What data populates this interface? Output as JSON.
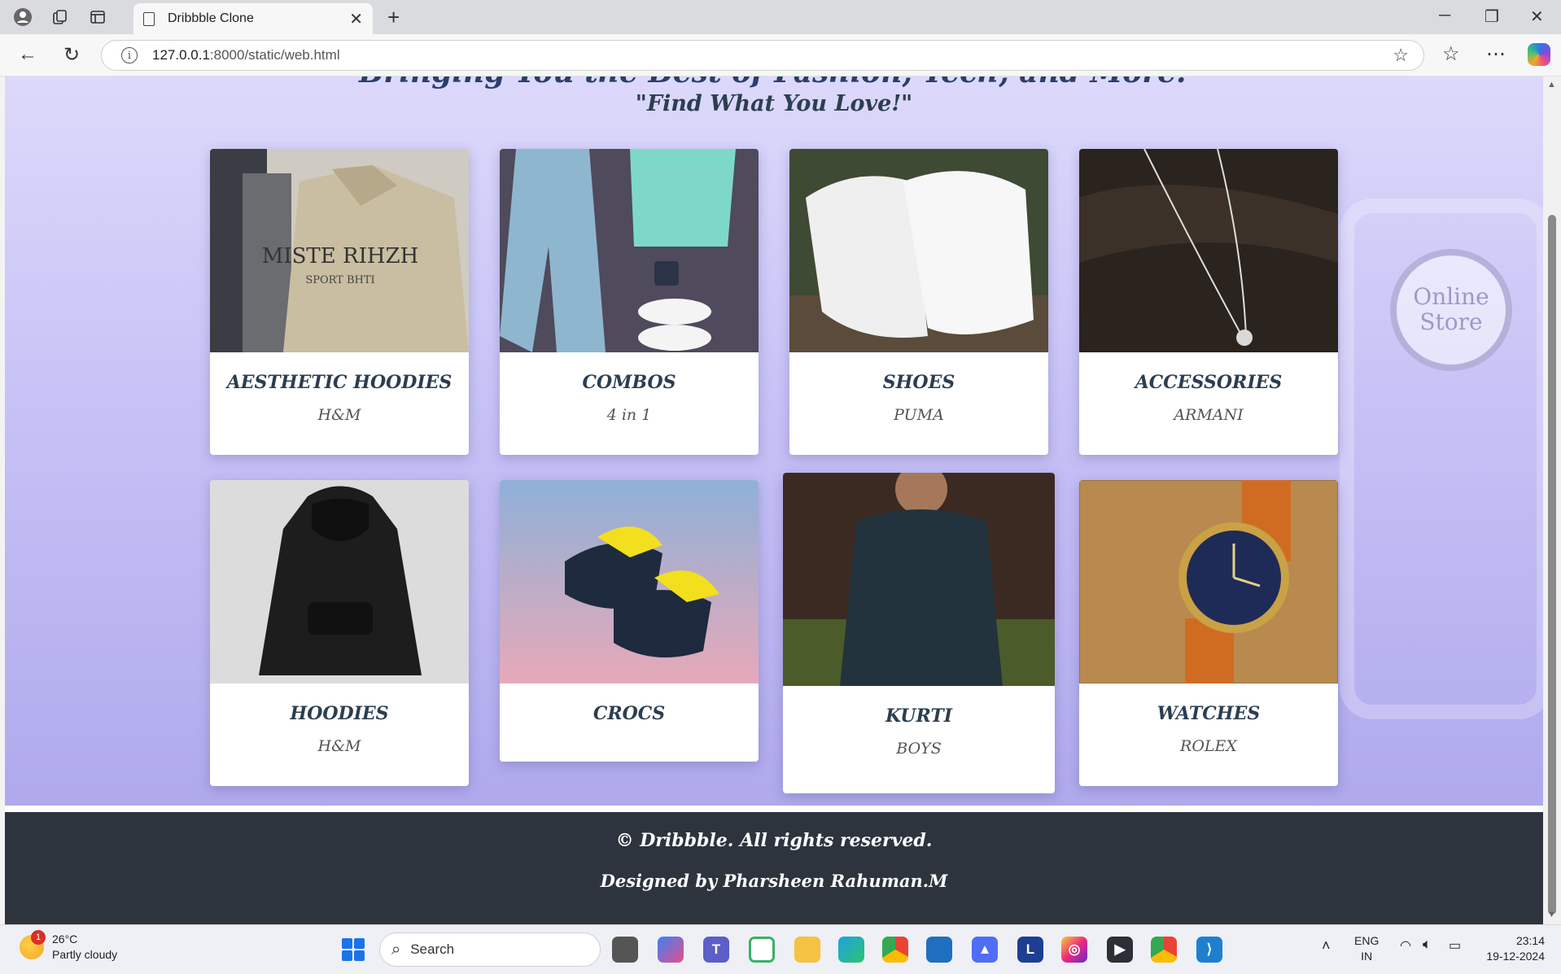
{
  "browser": {
    "tab_title": "Dribbble Clone",
    "url_host": "127.0.0.1",
    "url_rest": ":8000/static/web.html"
  },
  "hero": {
    "headline_partial": "Bringing You the Best of Fashion, Tech, and More!",
    "tagline": "\"Find What You Love!\""
  },
  "background": {
    "badge_text_line1": "Online",
    "badge_text_line2": "Store"
  },
  "cards": [
    {
      "name": "AESTHETIC HOODIES",
      "brand": "H&M",
      "image": "beige-hoodie-photo"
    },
    {
      "name": "COMBOS",
      "brand": "4 in 1",
      "image": "jeans-polo-sneakers-photo"
    },
    {
      "name": "SHOES",
      "brand": "PUMA",
      "image": "white-sneakers-photo"
    },
    {
      "name": "ACCESSORIES",
      "brand": "ARMANI",
      "image": "silver-necklace-photo"
    },
    {
      "name": "HOODIES",
      "brand": "H&M",
      "image": "black-hoodie-photo"
    },
    {
      "name": "CROCS",
      "brand": "",
      "image": "crocs-photo"
    },
    {
      "name": "KURTI",
      "brand": "BOYS",
      "image": "kurti-model-photo"
    },
    {
      "name": "WATCHES",
      "brand": "ROLEX",
      "image": "watch-photo"
    }
  ],
  "footer": {
    "copyright": "© Dribbble. All rights reserved.",
    "credit": "Designed by Pharsheen Rahuman.M"
  },
  "taskbar": {
    "weather_temp": "26°C",
    "weather_desc": "Partly cloudy",
    "weather_badge": "1",
    "search_placeholder": "Search",
    "lang_line1": "ENG",
    "lang_line2": "IN",
    "time": "23:14",
    "date": "19-12-2024"
  }
}
